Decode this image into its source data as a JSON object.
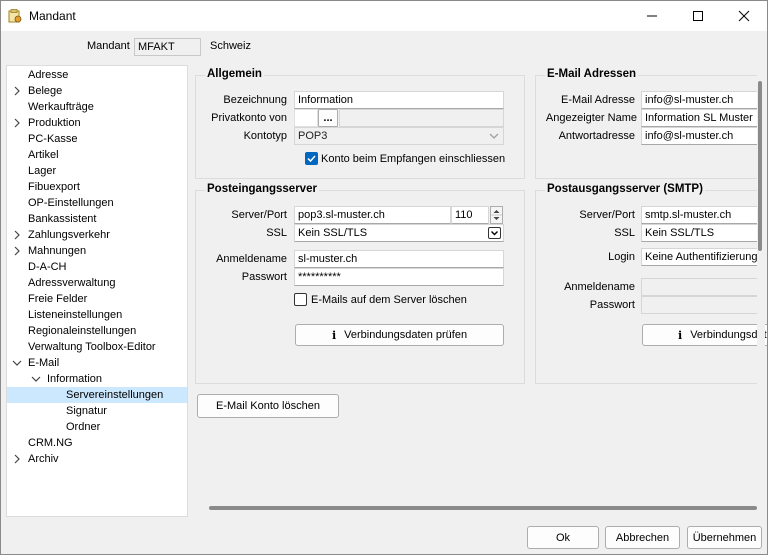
{
  "window": {
    "title": "Mandant"
  },
  "header": {
    "mandant_label": "Mandant",
    "mandant_code": "MFAKT",
    "mandant_name": "Schweiz"
  },
  "tree": {
    "items": [
      {
        "label": "Adresse",
        "expandable": false,
        "expanded": false,
        "level": 0
      },
      {
        "label": "Belege",
        "expandable": true,
        "expanded": false,
        "level": 0
      },
      {
        "label": "Werkaufträge",
        "expandable": false,
        "expanded": false,
        "level": 0
      },
      {
        "label": "Produktion",
        "expandable": true,
        "expanded": false,
        "level": 0
      },
      {
        "label": "PC-Kasse",
        "expandable": false,
        "expanded": false,
        "level": 0
      },
      {
        "label": "Artikel",
        "expandable": false,
        "expanded": false,
        "level": 0
      },
      {
        "label": "Lager",
        "expandable": false,
        "expanded": false,
        "level": 0
      },
      {
        "label": "Fibuexport",
        "expandable": false,
        "expanded": false,
        "level": 0
      },
      {
        "label": "OP-Einstellungen",
        "expandable": false,
        "expanded": false,
        "level": 0
      },
      {
        "label": "Bankassistent",
        "expandable": false,
        "expanded": false,
        "level": 0
      },
      {
        "label": "Zahlungsverkehr",
        "expandable": true,
        "expanded": false,
        "level": 0
      },
      {
        "label": "Mahnungen",
        "expandable": true,
        "expanded": false,
        "level": 0
      },
      {
        "label": "D-A-CH",
        "expandable": false,
        "expanded": false,
        "level": 0
      },
      {
        "label": "Adressverwaltung",
        "expandable": false,
        "expanded": false,
        "level": 0
      },
      {
        "label": "Freie Felder",
        "expandable": false,
        "expanded": false,
        "level": 0
      },
      {
        "label": "Listeneinstellungen",
        "expandable": false,
        "expanded": false,
        "level": 0
      },
      {
        "label": "Regionaleinstellungen",
        "expandable": false,
        "expanded": false,
        "level": 0
      },
      {
        "label": "Verwaltung Toolbox-Editor",
        "expandable": false,
        "expanded": false,
        "level": 0
      },
      {
        "label": "E-Mail",
        "expandable": true,
        "expanded": true,
        "level": 0
      },
      {
        "label": "Information",
        "expandable": true,
        "expanded": true,
        "level": 1
      },
      {
        "label": "Servereinstellungen",
        "expandable": false,
        "expanded": false,
        "level": 2,
        "selected": true
      },
      {
        "label": "Signatur",
        "expandable": false,
        "expanded": false,
        "level": 2
      },
      {
        "label": "Ordner",
        "expandable": false,
        "expanded": false,
        "level": 2
      },
      {
        "label": "CRM.NG",
        "expandable": false,
        "expanded": false,
        "level": 0
      },
      {
        "label": "Archiv",
        "expandable": true,
        "expanded": false,
        "level": 0
      }
    ]
  },
  "allgemein": {
    "title": "Allgemein",
    "bezeichnung_label": "Bezeichnung",
    "bezeichnung_value": "Information",
    "privatkonto_label": "Privatkonto von",
    "privatkonto_button": "...",
    "kontotyp_label": "Kontotyp",
    "kontotyp_value": "POP3",
    "empfangen_checkbox": "Konto beim Empfangen einschliessen",
    "empfangen_checked": true
  },
  "email_adressen": {
    "title": "E-Mail Adressen",
    "adresse_label": "E-Mail Adresse",
    "adresse_value": "info@sl-muster.ch",
    "name_label": "Angezeigter Name",
    "name_value": "Information SL Muster",
    "antwort_label": "Antwortadresse",
    "antwort_value": "info@sl-muster.ch"
  },
  "posteingang": {
    "title": "Posteingangsserver",
    "server_label": "Server/Port",
    "server_value": "pop3.sl-muster.ch",
    "port_value": "110",
    "ssl_label": "SSL",
    "ssl_value": "Kein SSL/TLS",
    "anmeldename_label": "Anmeldename",
    "anmeldename_value": "sl-muster.ch",
    "passwort_label": "Passwort",
    "passwort_value": "**********",
    "loeschen_checkbox": "E-Mails auf dem Server löschen",
    "loeschen_checked": false,
    "pruefen_button": "Verbindungsdaten prüfen"
  },
  "postausgang": {
    "title": "Postausgangsserver (SMTP)",
    "server_label": "Server/Port",
    "server_value": "smtp.sl-muster.ch",
    "ssl_label": "SSL",
    "ssl_value": "Kein SSL/TLS",
    "login_label": "Login",
    "login_value": "Keine Authentifizierung",
    "anmeldename_label": "Anmeldename",
    "passwort_label": "Passwort",
    "pruefen_button": "Verbindungsdaten prüfen"
  },
  "actions": {
    "delete_account": "E-Mail Konto löschen",
    "ok": "Ok",
    "cancel": "Abbrechen",
    "apply": "Übernehmen"
  }
}
